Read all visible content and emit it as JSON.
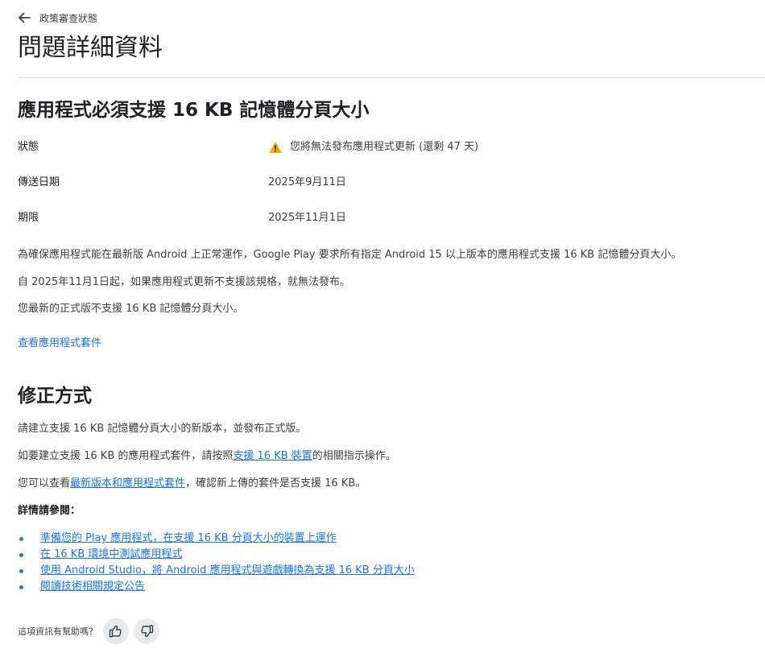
{
  "header": {
    "back_label": "政策審查狀態",
    "title": "問題詳細資料"
  },
  "issue": {
    "title_prefix": "應用程式必須支援 ",
    "title_bold": "16 KB",
    "title_suffix": " 記憶體分頁大小",
    "rows": [
      {
        "label": "狀態",
        "value": "您將無法發布應用程式更新 (還剩 47 天)"
      },
      {
        "label": "傳送日期",
        "value": "2025年9月11日"
      },
      {
        "label": "期限",
        "value": "2025年11月1日"
      }
    ],
    "paragraphs": [
      "為確保應用程式能在最新版 Android 上正常運作，Google Play 要求所有指定 Android 15 以上版本的應用程式支援 16 KB 記憶體分頁大小。",
      "自 2025年11月1日起，如果應用程式更新不支援該規格，就無法發布。",
      "您最新的正式版不支援 16 KB 記憶體分頁大小。"
    ],
    "view_bundle_link": "查看應用程式套件"
  },
  "fix": {
    "title": "修正方式",
    "p1": "請建立支援 16 KB 記憶體分頁大小的新版本，並發布正式版。",
    "p2_before": "如要建立支援 16 KB 的應用程式套件，請按照",
    "p2_link": "支援 16 KB 裝置",
    "p2_after": "的相關指示操作。",
    "p3_before": "您可以查看",
    "p3_link": "最新版本和應用程式套件",
    "p3_after": "，確認新上傳的套件是否支援 16 KB。",
    "more_label": "詳情請參閱：",
    "links": [
      "準備您的 Play 應用程式，在支援 16 KB 分頁大小的裝置上運作",
      "在 16 KB 環境中測試應用程式",
      "使用 Android Studio，將 Android 應用程式與遊戲轉換為支援 16 KB 分頁大小",
      "閱讀技術相關規定公告"
    ]
  },
  "feedback": {
    "label": "這項資訊有幫助嗎？"
  },
  "colors": {
    "link": "#1a73e8",
    "warning": "#f9ab00",
    "divider": "#dadce0"
  },
  "icons": {
    "back": "arrow-left-icon",
    "status": "warning-icon",
    "like": "thumb-up-icon",
    "dislike": "thumb-down-icon"
  }
}
